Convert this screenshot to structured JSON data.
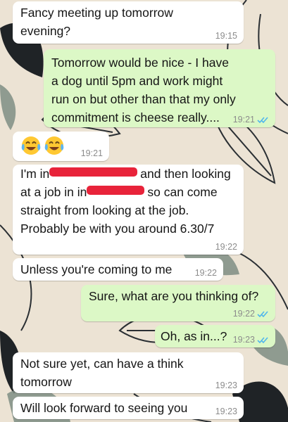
{
  "colors": {
    "incoming_bubble": "#FFFFFF",
    "outgoing_bubble": "#DCF8C6",
    "read_ticks": "#4FB6EC",
    "timestamp": "#8C8C8C",
    "redaction": "#E8233A",
    "wallpaper": "#ECE3D4"
  },
  "messages": [
    {
      "direction": "incoming",
      "text": "Fancy meeting up tomorrow\nevening?",
      "time": "19:15"
    },
    {
      "direction": "outgoing",
      "text": "Tomorrow would be nice - I have\na dog until 5pm and work might\nrun on but other than that my only\ncommitment is cheese really....",
      "time": "19:21",
      "status": "read"
    },
    {
      "direction": "incoming",
      "emoji": [
        "face-with-tears-of-joy",
        "face-with-tears-of-joy"
      ],
      "time": "19:21"
    },
    {
      "direction": "incoming",
      "line1_prefix": "I'm in",
      "line1_suffix": "and then looking",
      "line2_prefix": "at a job in in",
      "line2_suffix": "so can come",
      "text_rest": "straight from looking at the job.\nProbably be with you around 6.30/7",
      "time": "19:22"
    },
    {
      "direction": "incoming",
      "text": "Unless you're coming to me",
      "time": "19:22"
    },
    {
      "direction": "outgoing",
      "text": "Sure, what are you thinking of?",
      "time": "19:22",
      "status": "read"
    },
    {
      "direction": "outgoing",
      "text": "Oh, as in...?",
      "time": "19:23",
      "status": "read"
    },
    {
      "direction": "incoming",
      "text": "Not sure yet, can have a think\ntomorrow",
      "time": "19:23"
    },
    {
      "direction": "incoming",
      "text": "Will look forward to seeing you",
      "time": "19:23"
    }
  ]
}
